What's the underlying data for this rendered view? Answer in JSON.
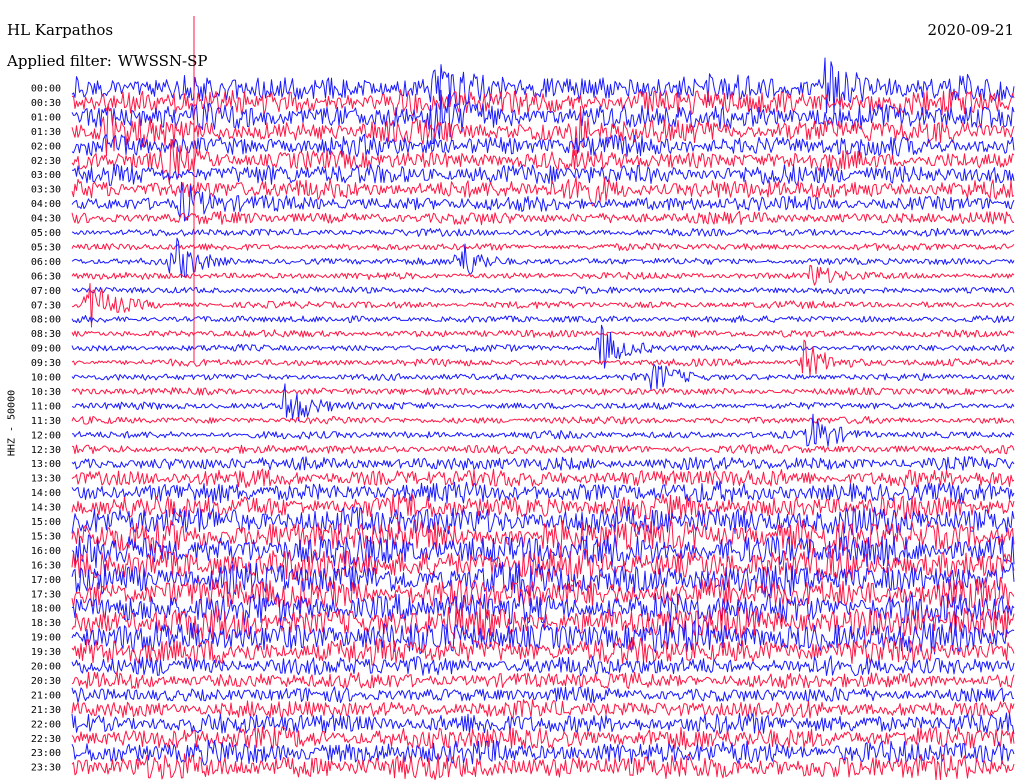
{
  "header": {
    "station": "HL Karpathos",
    "filter_label": "Applied filter:",
    "filter_value": "WWSSN-SP",
    "date": "2020-09-21",
    "channel": "HHZ - 50000"
  },
  "colors": {
    "trace_a": "#1a1aff",
    "trace_b": "#ff1744",
    "background": "#ffffff",
    "text": "#000000"
  },
  "chart_data": {
    "type": "line",
    "title": "HL Karpathos",
    "subtitle": "Applied filter: WWSSN-SP",
    "date": "2020-09-21",
    "ylabel": "HHZ - 50000",
    "xlabel": "",
    "row_labels": [
      "00:00",
      "00:30",
      "01:00",
      "01:30",
      "02:00",
      "02:30",
      "03:00",
      "03:30",
      "04:00",
      "04:30",
      "05:00",
      "05:30",
      "06:00",
      "06:30",
      "07:00",
      "07:30",
      "08:00",
      "08:30",
      "09:00",
      "09:30",
      "10:00",
      "10:30",
      "11:00",
      "11:30",
      "12:00",
      "12:30",
      "13:00",
      "13:30",
      "14:00",
      "14:30",
      "15:00",
      "15:30",
      "16:00",
      "16:30",
      "17:00",
      "17:30",
      "18:00",
      "18:30",
      "19:00",
      "19:30",
      "20:00",
      "20:30",
      "21:00",
      "21:30",
      "22:00",
      "22:30",
      "23:00",
      "23:30"
    ],
    "row_colors": [
      "blue",
      "red"
    ],
    "noise_level": [
      0.8,
      0.8,
      0.75,
      0.7,
      0.6,
      0.55,
      0.6,
      0.55,
      0.4,
      0.3,
      0.14,
      0.13,
      0.12,
      0.12,
      0.12,
      0.13,
      0.12,
      0.13,
      0.12,
      0.13,
      0.12,
      0.13,
      0.13,
      0.13,
      0.15,
      0.18,
      0.35,
      0.5,
      0.6,
      0.7,
      0.9,
      1.0,
      1.0,
      1.0,
      1.0,
      1.0,
      1.0,
      1.0,
      1.0,
      0.8,
      0.55,
      0.45,
      0.4,
      0.5,
      0.6,
      0.65,
      0.7,
      0.75
    ],
    "events": [
      {
        "row": 0,
        "minute": 24,
        "amplitude": 1.0
      },
      {
        "row": 0,
        "minute": 11.5,
        "amplitude": 0.6
      },
      {
        "row": 2,
        "minute": 11.5,
        "amplitude": 0.9
      },
      {
        "row": 3,
        "minute": 1,
        "amplitude": 0.9
      },
      {
        "row": 3,
        "minute": 16,
        "amplitude": 0.8
      },
      {
        "row": 5,
        "minute": 3,
        "amplitude": 0.7
      },
      {
        "row": 7,
        "minute": 16,
        "amplitude": 0.7
      },
      {
        "row": 8,
        "minute": 3.5,
        "amplitude": 0.8
      },
      {
        "row": 12,
        "minute": 3.2,
        "amplitude": 1.0
      },
      {
        "row": 12,
        "minute": 12.3,
        "amplitude": 0.9
      },
      {
        "row": 13,
        "minute": 23.5,
        "amplitude": 0.5
      },
      {
        "row": 15,
        "minute": 0.5,
        "amplitude": 1.0
      },
      {
        "row": 18,
        "minute": 16.8,
        "amplitude": 0.9
      },
      {
        "row": 19,
        "minute": 23.3,
        "amplitude": 0.8
      },
      {
        "row": 20,
        "minute": 18.5,
        "amplitude": 0.6
      },
      {
        "row": 22,
        "minute": 6.8,
        "amplitude": 1.0
      },
      {
        "row": 24,
        "minute": 23.5,
        "amplitude": 0.8
      }
    ]
  }
}
